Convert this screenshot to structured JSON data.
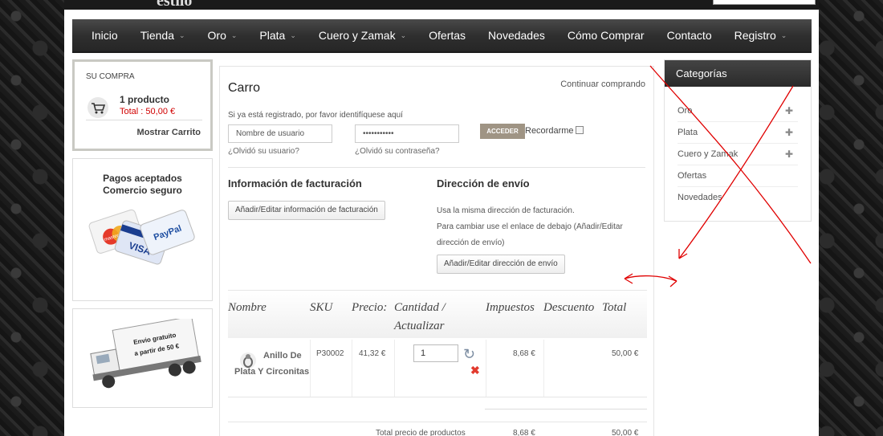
{
  "header": {
    "logo_fragment": "estilo"
  },
  "nav": [
    {
      "label": "Inicio",
      "dropdown": false
    },
    {
      "label": "Tienda",
      "dropdown": true
    },
    {
      "label": "Oro",
      "dropdown": true
    },
    {
      "label": "Plata",
      "dropdown": true
    },
    {
      "label": "Cuero y Zamak",
      "dropdown": true
    },
    {
      "label": "Ofertas",
      "dropdown": false
    },
    {
      "label": "Novedades",
      "dropdown": false
    },
    {
      "label": "Cómo Comprar",
      "dropdown": false
    },
    {
      "label": "Contacto",
      "dropdown": false
    },
    {
      "label": "Registro",
      "dropdown": true
    }
  ],
  "cart_widget": {
    "title": "SU COMPRA",
    "count": "1 producto",
    "total": "Total : 50,00 €",
    "show_cart": "Mostrar Carrito"
  },
  "payments": {
    "line1": "Pagos aceptados",
    "line2": "Comercio seguro",
    "card_labels": [
      "mastercard",
      "VISA",
      "PayPal"
    ]
  },
  "shipping_banner": {
    "line1": "Envio gratuito",
    "line2": "a partir de 50 €"
  },
  "cart": {
    "title": "Carro",
    "continue_link": "Continuar comprando",
    "login_hint": "Si ya está registrado, por favor identifíquese aquí",
    "username_value": "Nombre de usuario",
    "password_value": "•••••••••••",
    "login_button": "ACCEDER",
    "remember_label": "Recordarme",
    "forgot_user": "¿Olvidó su usuario?",
    "forgot_password": "¿Olvidó su contraseña?",
    "billing_title": "Información de facturación",
    "billing_button": "Añadir/Editar información de facturación",
    "shipping_title": "Dirección de envío",
    "shipping_line1": "Usa la misma dirección de facturación.",
    "shipping_line2": "Para cambiar use el enlace de debajo (Añadir/Editar dirección de envío)",
    "shipping_button": "Añadir/Editar dirección de envío",
    "columns": {
      "name": "Nombre",
      "sku": "SKU",
      "price": "Precio:",
      "qty": "Cantidad / Actualizar",
      "tax": "Impuestos",
      "discount": "Descuento",
      "total": "Total"
    },
    "item": {
      "name": "Anillo De Plata Y Circonitas",
      "sku": "P30002",
      "price": "41,32 €",
      "qty": "1",
      "tax": "8,68 €",
      "total": "50,00 €"
    },
    "totals": {
      "label": "Total precio de productos",
      "tax": "8,68 €",
      "total": "50,00 €"
    }
  },
  "categories": {
    "title": "Categorías",
    "items": [
      {
        "label": "Oro",
        "expandable": true
      },
      {
        "label": "Plata",
        "expandable": true
      },
      {
        "label": "Cuero y Zamak",
        "expandable": true
      },
      {
        "label": "Ofertas",
        "expandable": false
      },
      {
        "label": "Novedades",
        "expandable": false
      }
    ]
  },
  "colors": {
    "accent_login": "#9f9484",
    "price_red": "#d10000",
    "annotation": "#e00000"
  }
}
